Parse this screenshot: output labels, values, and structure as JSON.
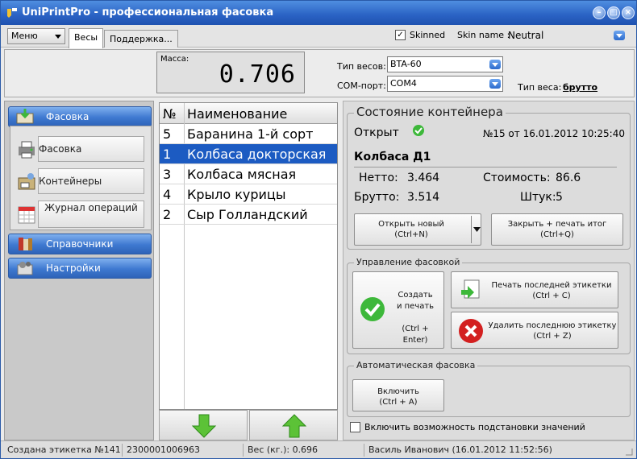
{
  "window": {
    "title": "UniPrintPro - профессиональная фасовка"
  },
  "menubar": {
    "menu_label": "Меню",
    "tabs": [
      {
        "label": "Весы"
      },
      {
        "label": "Поддержка..."
      }
    ],
    "skinned_label": "Skinned",
    "skinned_checked": true,
    "skin_name_label": "Skin name :",
    "skin_name_value": "Neutral"
  },
  "scale": {
    "mass_label": "Масса:",
    "mass_value": "0.706",
    "scale_type_label": "Тип весов:",
    "scale_type_value": "BTA-60",
    "com_label": "COM-порт:",
    "com_value": "COM4",
    "weight_type_label": "Тип веса:",
    "weight_type_value": "брутто"
  },
  "nav": {
    "fasovka": "Фасовка",
    "sub": [
      {
        "label": "Фасовка"
      },
      {
        "label": "Контейнеры"
      },
      {
        "label": "Журнал операций"
      }
    ],
    "spravochniki": "Справочники",
    "nastroiki": "Настройки"
  },
  "list": {
    "col_no": "№",
    "col_name": "Наименование",
    "rows": [
      {
        "no": "5",
        "name": "Баранина 1-й сорт",
        "selected": false
      },
      {
        "no": "1",
        "name": "Колбаса докторская",
        "selected": true
      },
      {
        "no": "3",
        "name": "Колбаса мясная",
        "selected": false
      },
      {
        "no": "4",
        "name": "Крыло курицы",
        "selected": false
      },
      {
        "no": "2",
        "name": "Сыр Голландский",
        "selected": false
      }
    ]
  },
  "container": {
    "title": "Состояние контейнера",
    "state": "Открыт",
    "doc": "№15 от 16.01.2012 10:25:40",
    "product": "Колбаса Д1",
    "netto_label": "Нетто:",
    "netto_value": "3.464",
    "cost_label": "Стоимость:",
    "cost_value": "86.6",
    "brutto_label": "Брутто:",
    "brutto_value": "3.514",
    "count_label": "Штук:",
    "count_value": "5",
    "open_new_line1": "Открыть новый",
    "open_new_line2": "(Ctrl+N)",
    "close_print_line1": "Закрыть + печать итог",
    "close_print_line2": "(Ctrl+Q)"
  },
  "packing": {
    "title": "Управление фасовкой",
    "create_line1": "Создать",
    "create_line2": "и печать",
    "create_line3": "(Ctrl + Enter)",
    "print_last_line1": "Печать последней этикетки",
    "print_last_line2": "(Ctrl + C)",
    "delete_last_line1": "Удалить последнюю этикетку",
    "delete_last_line2": "(Ctrl + Z)"
  },
  "auto": {
    "title": "Автоматическая фасовка",
    "enable_line1": "Включить",
    "enable_line2": "(Ctrl + A)",
    "substitute_label": "Включить возможность подстановки значений"
  },
  "status": {
    "label": "Создана этикетка №141",
    "barcode": "2300001006963",
    "weight": "Вес (кг.): 0.696",
    "user": "Василь Иванович (16.01.2012 11:52:56)"
  },
  "colors": {
    "accent": "#2e6ad0",
    "selected_row": "#1c5bc2",
    "ok_green": "#3db83a",
    "delete_red": "#d32020"
  }
}
